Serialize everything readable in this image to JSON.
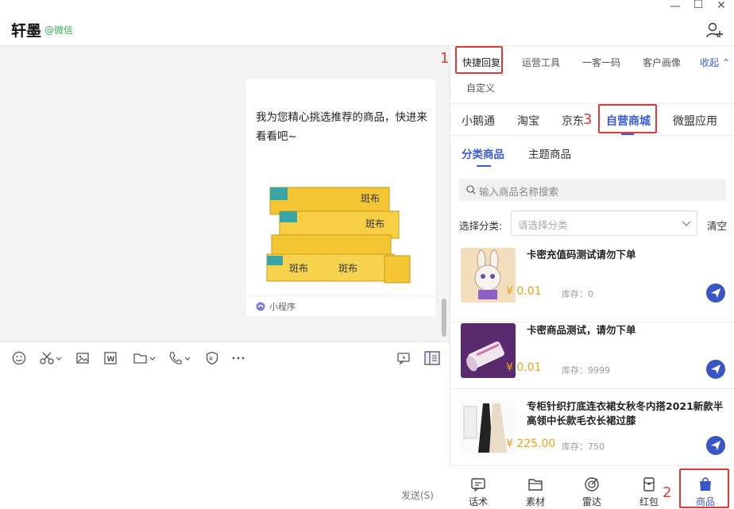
{
  "header": {
    "title": "轩墨",
    "source": "@微信"
  },
  "chat": {
    "card_text": "我为您精心挑选推荐的商品，快进来看看吧~",
    "card_footer": "小程序",
    "send_label": "发送(S)"
  },
  "panel": {
    "tabs_primary": [
      "快捷回复",
      "运营工具",
      "一客一码",
      "客户画像"
    ],
    "tab_custom": "自定义",
    "collapse_label": "收起",
    "tabs_store": [
      "小鹅通",
      "淘宝",
      "京东",
      "自营商城",
      "微盟应用"
    ],
    "tabs_product": [
      "分类商品",
      "主题商品"
    ],
    "search_placeholder": "输入商品名称搜索",
    "category_label": "选择分类:",
    "category_placeholder": "请选择分类",
    "clear_label": "清空",
    "products": [
      {
        "name": "卡密充值码测试请勿下单",
        "price": "¥ 0.01",
        "stock": "库存：0"
      },
      {
        "name": "卡密商品测试，请勿下单",
        "price": "¥ 0.01",
        "stock": "库存：9999"
      },
      {
        "name": "专柜针织打底连衣裙女秋冬内搭2021新款半高领中长款毛衣长裙过膝",
        "price": "¥ 225.00",
        "stock": "库存：750"
      }
    ]
  },
  "bottom_nav": [
    "话术",
    "素材",
    "雷达",
    "红包",
    "商品"
  ],
  "annotations": [
    "1",
    "2",
    "3"
  ],
  "colors": {
    "accent": "#3a5bd9",
    "price": "#e8a317",
    "annotation": "#e53935",
    "source": "#3cab5a"
  }
}
